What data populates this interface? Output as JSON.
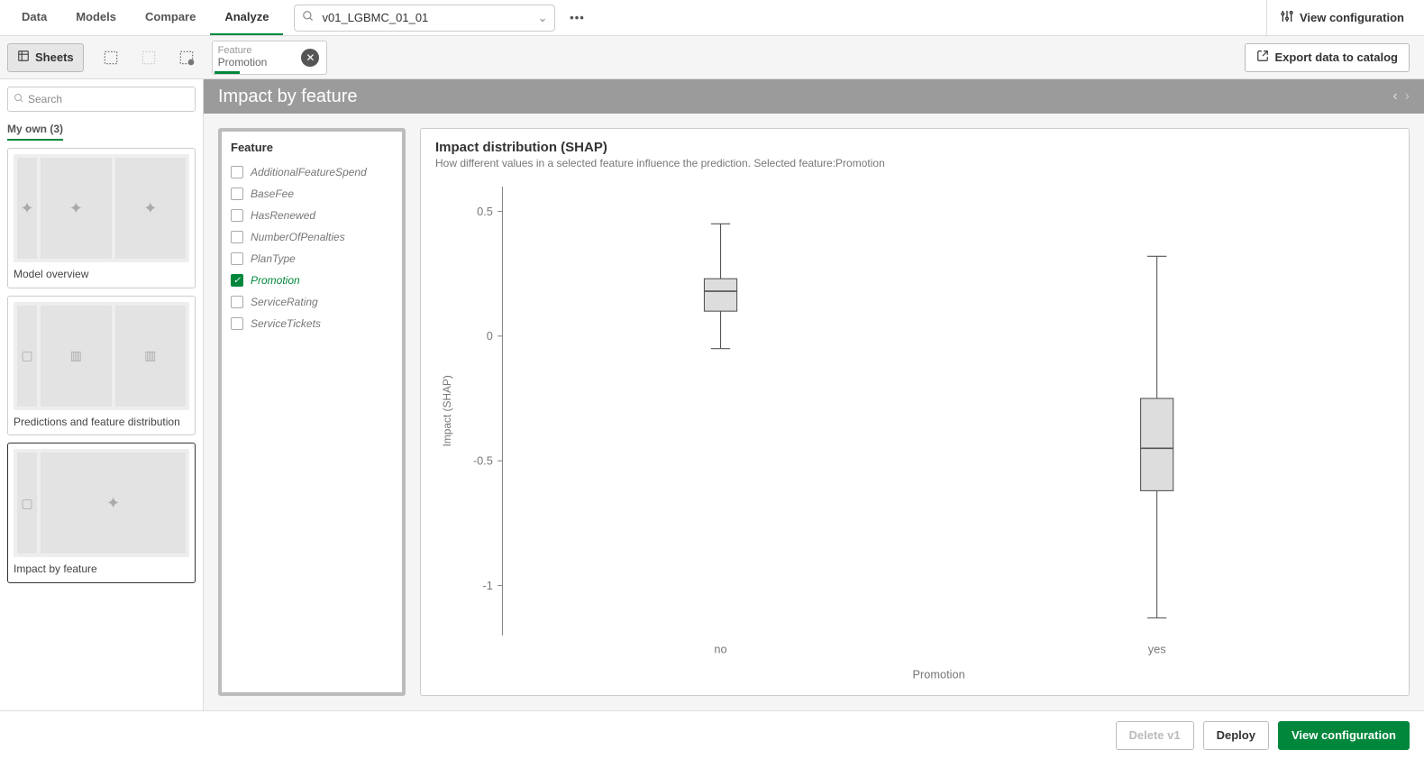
{
  "nav": {
    "tabs": [
      "Data",
      "Models",
      "Compare",
      "Analyze"
    ],
    "active": 3,
    "version_label": "v01_LGBMC_01_01",
    "view_config": "View configuration"
  },
  "toolrow": {
    "sheets_label": "Sheets",
    "feature_chip_label": "Feature",
    "feature_chip_value": "Promotion",
    "export_label": "Export data to catalog"
  },
  "sidebar": {
    "search_placeholder": "Search",
    "group_label": "My own (3)",
    "sheets": [
      {
        "label": "Model overview"
      },
      {
        "label": "Predictions and feature distribution"
      },
      {
        "label": "Impact by feature"
      }
    ],
    "selected": 2
  },
  "page": {
    "title": "Impact by feature"
  },
  "feature_panel": {
    "title": "Feature",
    "items": [
      {
        "name": "AdditionalFeatureSpend",
        "checked": false
      },
      {
        "name": "BaseFee",
        "checked": false
      },
      {
        "name": "HasRenewed",
        "checked": false
      },
      {
        "name": "NumberOfPenalties",
        "checked": false
      },
      {
        "name": "PlanType",
        "checked": false
      },
      {
        "name": "Promotion",
        "checked": true
      },
      {
        "name": "ServiceRating",
        "checked": false
      },
      {
        "name": "ServiceTickets",
        "checked": false
      }
    ]
  },
  "chart": {
    "title": "Impact distribution (SHAP)",
    "subtitle": "How different values in a selected feature influence the prediction. Selected feature:Promotion",
    "ylabel": "Impact (SHAP)",
    "xlabel": "Promotion"
  },
  "footer": {
    "delete_label": "Delete v1",
    "deploy_label": "Deploy",
    "view_config_label": "View configuration"
  },
  "chart_data": {
    "type": "boxplot",
    "title": "Impact distribution (SHAP)",
    "xlabel": "Promotion",
    "ylabel": "Impact (SHAP)",
    "ylim": [
      -1.2,
      0.6
    ],
    "yticks": [
      -1,
      -0.5,
      0,
      0.5
    ],
    "categories": [
      "no",
      "yes"
    ],
    "series": [
      {
        "category": "no",
        "min": -0.05,
        "q1": 0.1,
        "median": 0.18,
        "q3": 0.23,
        "max": 0.45
      },
      {
        "category": "yes",
        "min": -1.13,
        "q1": -0.62,
        "median": -0.45,
        "q3": -0.25,
        "max": 0.32
      }
    ]
  }
}
